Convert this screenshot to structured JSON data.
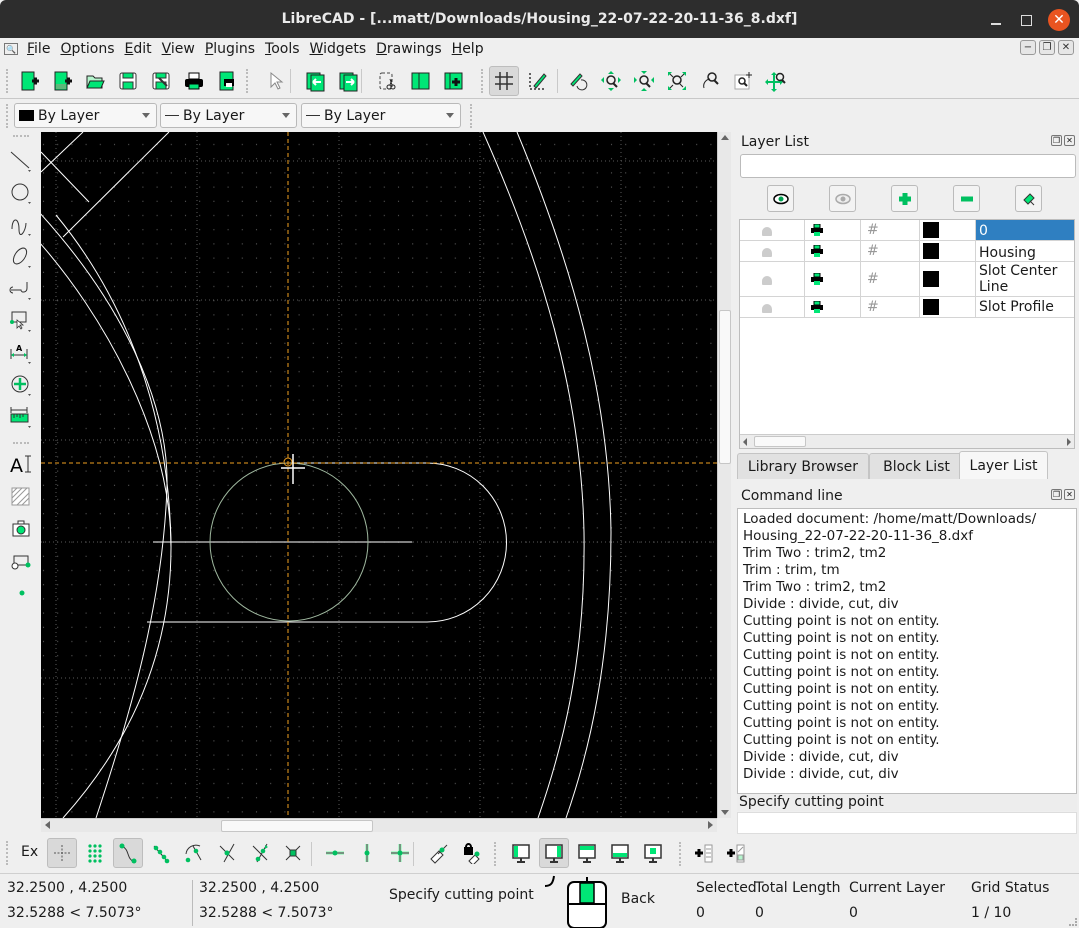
{
  "window": {
    "title": "LibreCAD - [...matt/Downloads/Housing_22-07-22-20-11-36_8.dxf]",
    "controls": [
      "minimize",
      "maximize",
      "close"
    ]
  },
  "menu": {
    "items": [
      "File",
      "Options",
      "Edit",
      "View",
      "Plugins",
      "Tools",
      "Widgets",
      "Drawings",
      "Help"
    ]
  },
  "toolbar_main": {
    "buttons": [
      {
        "name": "new-icon",
        "label": "New"
      },
      {
        "name": "new-from-template-icon",
        "label": "New from template"
      },
      {
        "name": "open-icon",
        "label": "Open"
      },
      {
        "name": "save-icon",
        "label": "Save"
      },
      {
        "name": "save-as-icon",
        "label": "Save As"
      },
      {
        "name": "print-icon",
        "label": "Print"
      },
      {
        "name": "print-preview-icon",
        "label": "Print Preview"
      },
      {
        "name": "select-pointer-icon",
        "label": "Select"
      },
      {
        "name": "undo-icon",
        "label": "Undo"
      },
      {
        "name": "redo-icon",
        "label": "Redo"
      },
      {
        "name": "cut-icon",
        "label": "Cut"
      },
      {
        "name": "copy-icon",
        "label": "Copy"
      },
      {
        "name": "paste-icon",
        "label": "Paste"
      },
      {
        "name": "grid-icon",
        "label": "Show Grid",
        "active": true
      },
      {
        "name": "draft-icon",
        "label": "Draft"
      },
      {
        "name": "redraw-icon",
        "label": "Redraw"
      },
      {
        "name": "zoom-in-icon",
        "label": "Zoom In"
      },
      {
        "name": "zoom-out-icon",
        "label": "Zoom Out"
      },
      {
        "name": "zoom-auto-icon",
        "label": "Auto Zoom"
      },
      {
        "name": "zoom-previous-icon",
        "label": "Previous View"
      },
      {
        "name": "zoom-window-icon",
        "label": "Window Zoom"
      },
      {
        "name": "zoom-pan-icon",
        "label": "Zoom Panning"
      }
    ]
  },
  "pen_toolbar": {
    "color": "By Layer",
    "line_width": "By Layer",
    "line_type": "By Layer"
  },
  "left_tools": [
    "line",
    "circle",
    "curve",
    "ellipse",
    "polyline",
    "select",
    "dimension",
    "modify",
    "info",
    "text",
    "hatch",
    "image",
    "block",
    "point"
  ],
  "layer_list": {
    "title": "Layer List",
    "filter_placeholder": "",
    "buttons": [
      "show-all-layers",
      "hide-all-layers",
      "add-layer",
      "remove-layer",
      "edit-layer"
    ],
    "layers": [
      {
        "name": "0",
        "selected": true,
        "color": "#000000"
      },
      {
        "name": "Housing",
        "selected": false,
        "color": "#000000"
      },
      {
        "name": "Slot Center Line",
        "selected": false,
        "color": "#000000"
      },
      {
        "name": "Slot Profile",
        "selected": false,
        "color": "#000000"
      }
    ]
  },
  "dock_tabs": [
    {
      "label": "Library Browser",
      "active": false
    },
    {
      "label": "Block List",
      "active": false
    },
    {
      "label": "Layer List",
      "active": true
    }
  ],
  "command_line": {
    "title": "Command line",
    "log": [
      "Loaded document: /home/matt/Downloads/",
      "Housing_22-07-22-20-11-36_8.dxf",
      "Trim Two : trim2, tm2",
      "Trim : trim, tm",
      "Trim Two : trim2, tm2",
      "Divide : divide, cut, div",
      "Cutting point is not on entity.",
      "Cutting point is not on entity.",
      "Cutting point is not on entity.",
      "Cutting point is not on entity.",
      "Cutting point is not on entity.",
      "Cutting point is not on entity.",
      "Cutting point is not on entity.",
      "Cutting point is not on entity.",
      "Divide : divide, cut, div",
      "Divide : divide, cut, div"
    ],
    "prompt": "Specify cutting point",
    "input_value": ""
  },
  "snap_toolbar": {
    "label": "Ex",
    "buttons": [
      {
        "name": "snap-free-icon",
        "active": true
      },
      {
        "name": "snap-grid-icon",
        "active": false
      },
      {
        "name": "snap-endpoint-icon",
        "active": true
      },
      {
        "name": "snap-on-entity-icon",
        "active": false
      },
      {
        "name": "snap-center-icon",
        "active": false
      },
      {
        "name": "snap-middle-icon",
        "active": false
      },
      {
        "name": "snap-distance-icon",
        "active": false
      },
      {
        "name": "snap-intersection-icon",
        "active": false
      },
      {
        "name": "restrict-horizontal-icon",
        "active": false
      },
      {
        "name": "restrict-vertical-icon",
        "active": false
      },
      {
        "name": "restrict-orthogonal-icon",
        "active": false
      },
      {
        "name": "relative-zero-icon",
        "active": false
      },
      {
        "name": "lock-relative-zero-icon",
        "active": false
      },
      {
        "name": "view-layout-1-icon",
        "active": false
      },
      {
        "name": "view-layout-2-icon",
        "active": true
      },
      {
        "name": "view-layout-3-icon",
        "active": false
      },
      {
        "name": "view-layout-4-icon",
        "active": false
      },
      {
        "name": "view-layout-5-icon",
        "active": false
      },
      {
        "name": "add-layer-list-icon",
        "active": false
      },
      {
        "name": "add-block-list-icon",
        "active": false
      }
    ]
  },
  "status": {
    "abs_coords": "32.2500 , 4.2500",
    "abs_polar": "32.5288 < 7.5073°",
    "rel_coords": "32.2500 , 4.2500",
    "rel_polar": "32.5288 < 7.5073°",
    "prompt": "Specify cutting point",
    "mouse_right": "Back",
    "selected_label": "Selected",
    "selected_value": "0",
    "total_length_label": "Total Length",
    "total_length_value": "0",
    "current_layer_label": "Current Layer",
    "current_layer_value": "0",
    "grid_status_label": "Grid Status",
    "grid_status_value": "1 / 10"
  },
  "colors": {
    "accent_green": "#00e676",
    "selection_blue": "#2f7fc1",
    "close_orange": "#e95420",
    "crosshair_orange": "#f0a020",
    "canvas_bg": "#000000"
  }
}
